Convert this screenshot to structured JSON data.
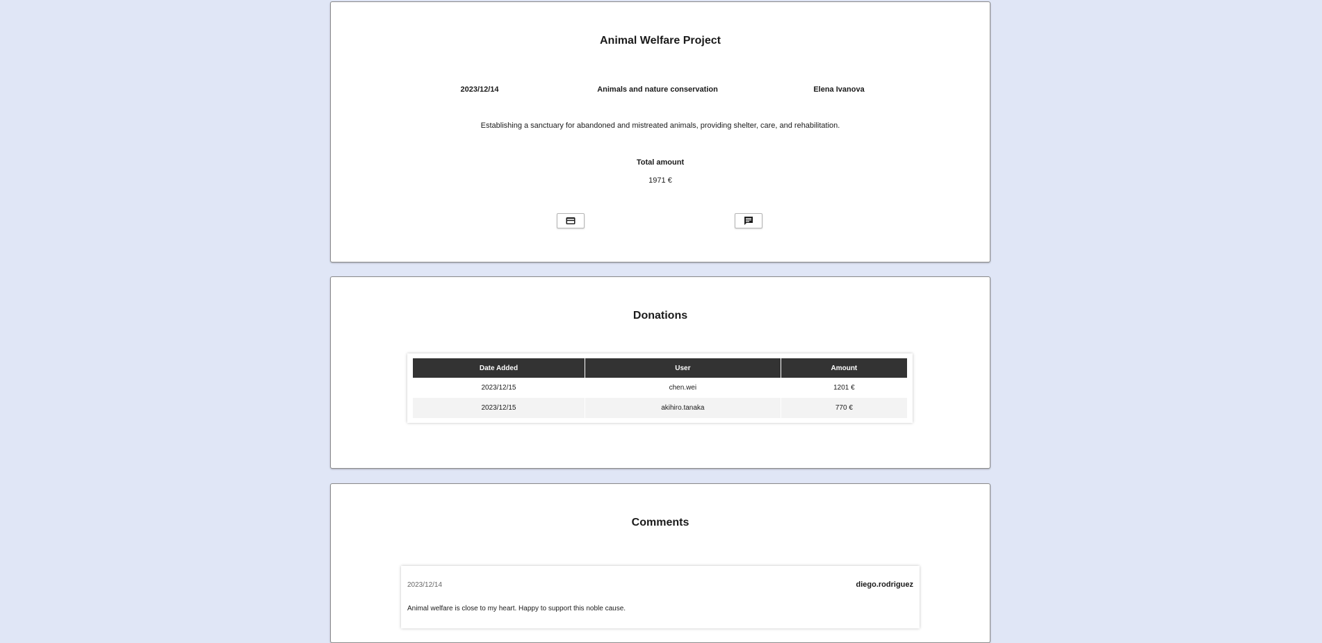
{
  "project": {
    "title": "Animal Welfare Project",
    "date": "2023/12/14",
    "category": "Animals and nature conservation",
    "author": "Elena Ivanova",
    "description": "Establishing a sanctuary for abandoned and mistreated animals, providing shelter, care, and rehabilitation.",
    "total_label": "Total amount",
    "total_value": "1971 €",
    "buttons": [
      {
        "icon": "credit-card-icon"
      },
      {
        "icon": "comment-icon"
      }
    ]
  },
  "donations": {
    "title": "Donations",
    "columns": [
      "Date Added",
      "User",
      "Amount"
    ],
    "rows": [
      [
        "2023/12/15",
        "chen.wei",
        "1201 €"
      ],
      [
        "2023/12/15",
        "akihiro.tanaka",
        "770 €"
      ]
    ]
  },
  "comments": {
    "title": "Comments",
    "items": [
      {
        "date": "2023/12/14",
        "user": "diego.rodriguez",
        "text": "Animal welfare is close to my heart. Happy to support this noble cause."
      }
    ]
  }
}
